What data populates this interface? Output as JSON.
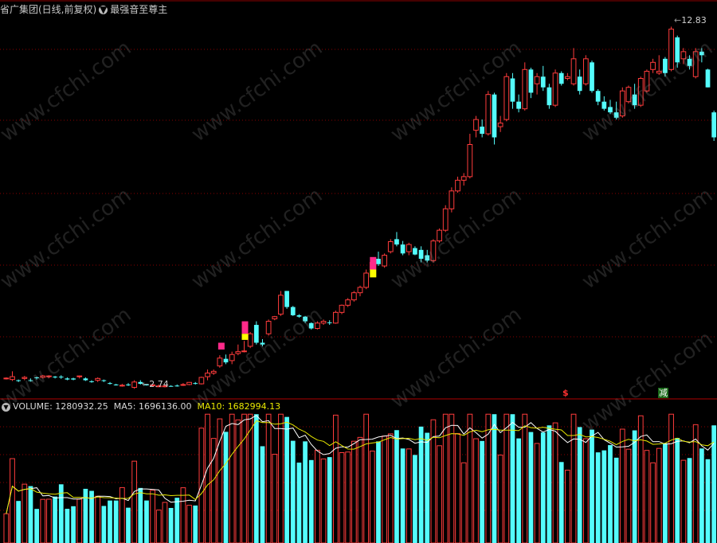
{
  "header": {
    "title": "省广集团(日线,前复权)",
    "indicator": "最强音至尊主",
    "toggle_icon": "chevron-down-icon"
  },
  "price_labels": {
    "high": "12.83",
    "low": "2.74"
  },
  "signals": {
    "sell": "$",
    "reduce": "减"
  },
  "volume_header": {
    "volume": "VOLUME: 1280932.25",
    "ma5": "MA5: 1696136.00",
    "ma10": "MA10: 1682994.13"
  },
  "watermark": "www.cfchi.com",
  "colors": {
    "up": "#ff3c3c",
    "down": "#54fcfc",
    "grid": "#8a0000",
    "ma5": "#ffffff",
    "ma10": "#e8e800",
    "magenta": "#ff2a8a",
    "yellow": "#ffff00"
  },
  "chart_data": {
    "type": "candlestick",
    "price_ylim": [
      2.5,
      13.2
    ],
    "candles": [
      [
        3.05,
        3.08,
        3.02,
        3.06
      ],
      [
        3.02,
        3.25,
        2.98,
        3.1
      ],
      [
        3.0,
        3.02,
        2.95,
        2.98
      ],
      [
        3.05,
        3.12,
        3.0,
        3.08
      ],
      [
        3.0,
        3.05,
        2.96,
        2.98
      ],
      [
        3.08,
        3.1,
        3.02,
        3.06
      ],
      [
        3.08,
        3.15,
        3.05,
        3.12
      ],
      [
        3.1,
        3.14,
        3.06,
        3.12
      ],
      [
        3.1,
        3.12,
        3.05,
        3.08
      ],
      [
        3.1,
        3.14,
        3.04,
        3.08
      ],
      [
        3.05,
        3.08,
        3.0,
        3.02
      ],
      [
        3.05,
        3.07,
        3.0,
        3.02
      ],
      [
        3.1,
        3.13,
        3.05,
        3.12
      ],
      [
        3.05,
        3.08,
        2.98,
        3.0
      ],
      [
        2.97,
        3.0,
        2.93,
        2.95
      ],
      [
        3.0,
        3.08,
        2.95,
        3.05
      ],
      [
        3.0,
        3.02,
        2.95,
        2.98
      ],
      [
        2.92,
        2.95,
        2.88,
        2.9
      ],
      [
        2.88,
        2.9,
        2.85,
        2.87
      ],
      [
        2.85,
        2.9,
        2.82,
        2.86
      ],
      [
        2.88,
        2.92,
        2.84,
        2.86
      ],
      [
        2.8,
        3.0,
        2.76,
        2.95
      ],
      [
        2.95,
        3.0,
        2.88,
        2.9
      ],
      [
        2.88,
        2.9,
        2.85,
        2.86
      ],
      [
        2.86,
        2.9,
        2.83,
        2.87
      ],
      [
        2.83,
        2.88,
        2.81,
        2.84
      ],
      [
        2.84,
        2.88,
        2.8,
        2.84
      ],
      [
        2.84,
        2.86,
        2.82,
        2.83
      ],
      [
        2.85,
        2.88,
        2.82,
        2.84
      ],
      [
        2.87,
        2.92,
        2.84,
        2.88
      ],
      [
        2.88,
        2.95,
        2.86,
        2.94
      ],
      [
        2.92,
        2.95,
        2.88,
        2.9
      ],
      [
        2.9,
        3.1,
        2.88,
        3.08
      ],
      [
        3.1,
        3.3,
        3.0,
        3.2
      ],
      [
        3.2,
        3.3,
        3.15,
        3.25
      ],
      [
        3.4,
        3.7,
        3.35,
        3.62
      ],
      [
        3.6,
        3.72,
        3.45,
        3.5
      ],
      [
        3.55,
        3.8,
        3.45,
        3.72
      ],
      [
        3.75,
        4.0,
        3.7,
        3.8
      ],
      [
        3.8,
        4.1,
        3.78,
        3.82
      ],
      [
        3.95,
        4.35,
        3.9,
        4.3
      ],
      [
        4.55,
        4.65,
        4.0,
        4.05
      ],
      [
        4.05,
        4.15,
        3.95,
        4.0
      ],
      [
        4.3,
        4.7,
        4.25,
        4.65
      ],
      [
        4.72,
        4.8,
        4.68,
        4.78
      ],
      [
        4.85,
        5.5,
        4.8,
        5.38
      ],
      [
        5.5,
        5.5,
        5.0,
        5.05
      ],
      [
        5.05,
        5.08,
        4.8,
        4.82
      ],
      [
        4.82,
        4.85,
        4.75,
        4.78
      ],
      [
        4.78,
        4.8,
        4.6,
        4.65
      ],
      [
        4.6,
        4.62,
        4.42,
        4.45
      ],
      [
        4.45,
        4.65,
        4.42,
        4.6
      ],
      [
        4.6,
        4.7,
        4.55,
        4.65
      ],
      [
        4.62,
        4.68,
        4.55,
        4.6
      ],
      [
        4.6,
        4.95,
        4.58,
        4.9
      ],
      [
        4.9,
        5.12,
        4.85,
        5.1
      ],
      [
        5.1,
        5.3,
        5.05,
        5.25
      ],
      [
        5.25,
        5.5,
        5.2,
        5.45
      ],
      [
        5.45,
        5.65,
        5.35,
        5.6
      ],
      [
        5.6,
        6.1,
        5.55,
        6.0
      ],
      [
        6.1,
        6.4,
        6.05,
        6.3
      ],
      [
        6.4,
        6.6,
        6.2,
        6.25
      ],
      [
        6.2,
        6.55,
        6.15,
        6.5
      ],
      [
        6.6,
        6.95,
        6.55,
        6.88
      ],
      [
        6.95,
        7.15,
        6.75,
        6.8
      ],
      [
        6.8,
        6.9,
        6.5,
        6.55
      ],
      [
        6.6,
        6.85,
        6.5,
        6.8
      ],
      [
        6.7,
        6.75,
        6.5,
        6.52
      ],
      [
        6.65,
        6.75,
        6.3,
        6.4
      ],
      [
        6.5,
        6.65,
        6.3,
        6.35
      ],
      [
        6.35,
        6.95,
        6.3,
        6.9
      ],
      [
        6.9,
        7.25,
        6.85,
        7.2
      ],
      [
        7.2,
        7.9,
        7.15,
        7.8
      ],
      [
        7.8,
        8.4,
        7.7,
        8.3
      ],
      [
        8.3,
        8.7,
        8.25,
        8.6
      ],
      [
        8.6,
        8.8,
        8.45,
        8.7
      ],
      [
        8.7,
        9.9,
        8.65,
        9.6
      ],
      [
        10.0,
        10.4,
        9.8,
        10.3
      ],
      [
        10.1,
        10.3,
        9.8,
        9.9
      ],
      [
        9.9,
        11.1,
        9.85,
        11.0
      ],
      [
        11.0,
        11.05,
        9.6,
        9.8
      ],
      [
        10.1,
        10.4,
        9.95,
        10.2
      ],
      [
        10.3,
        11.6,
        10.25,
        11.5
      ],
      [
        11.45,
        11.6,
        10.6,
        10.8
      ],
      [
        10.8,
        11.0,
        10.5,
        10.6
      ],
      [
        10.6,
        11.9,
        10.55,
        11.7
      ],
      [
        11.7,
        11.75,
        10.9,
        11.05
      ],
      [
        11.3,
        11.6,
        11.0,
        11.5
      ],
      [
        11.5,
        11.8,
        11.1,
        11.2
      ],
      [
        11.2,
        11.3,
        10.6,
        10.7
      ],
      [
        10.7,
        11.7,
        10.65,
        11.6
      ],
      [
        11.6,
        11.65,
        11.25,
        11.3
      ],
      [
        11.45,
        11.6,
        11.4,
        11.5
      ],
      [
        11.3,
        12.3,
        11.25,
        12.0
      ],
      [
        11.5,
        11.7,
        11.0,
        11.1
      ],
      [
        11.3,
        12.1,
        11.25,
        12.0
      ],
      [
        11.9,
        11.95,
        11.05,
        11.1
      ],
      [
        11.1,
        11.15,
        10.7,
        10.8
      ],
      [
        10.8,
        10.95,
        10.55,
        10.6
      ],
      [
        10.65,
        10.85,
        10.45,
        10.5
      ],
      [
        10.5,
        10.8,
        10.3,
        10.35
      ],
      [
        10.4,
        11.2,
        10.35,
        11.1
      ],
      [
        10.8,
        11.25,
        10.75,
        11.2
      ],
      [
        11.0,
        11.3,
        10.6,
        10.7
      ],
      [
        10.7,
        11.5,
        10.65,
        11.45
      ],
      [
        11.1,
        11.7,
        11.05,
        11.65
      ],
      [
        11.7,
        12.0,
        11.6,
        11.9
      ],
      [
        11.6,
        12.1,
        11.55,
        11.65
      ],
      [
        12.0,
        12.05,
        11.5,
        11.6
      ],
      [
        11.7,
        12.9,
        11.65,
        12.83
      ],
      [
        12.6,
        12.65,
        11.75,
        11.9
      ],
      [
        12.0,
        12.3,
        11.85,
        12.2
      ],
      [
        12.0,
        12.1,
        11.7,
        11.8
      ],
      [
        11.5,
        12.3,
        11.45,
        12.2
      ],
      [
        12.2,
        12.3,
        11.9,
        12.1
      ],
      [
        11.7,
        11.72,
        11.2,
        11.2
      ],
      [
        10.5,
        10.55,
        9.7,
        9.8
      ]
    ],
    "volume_ylim": [
      0,
      3200000
    ]
  }
}
